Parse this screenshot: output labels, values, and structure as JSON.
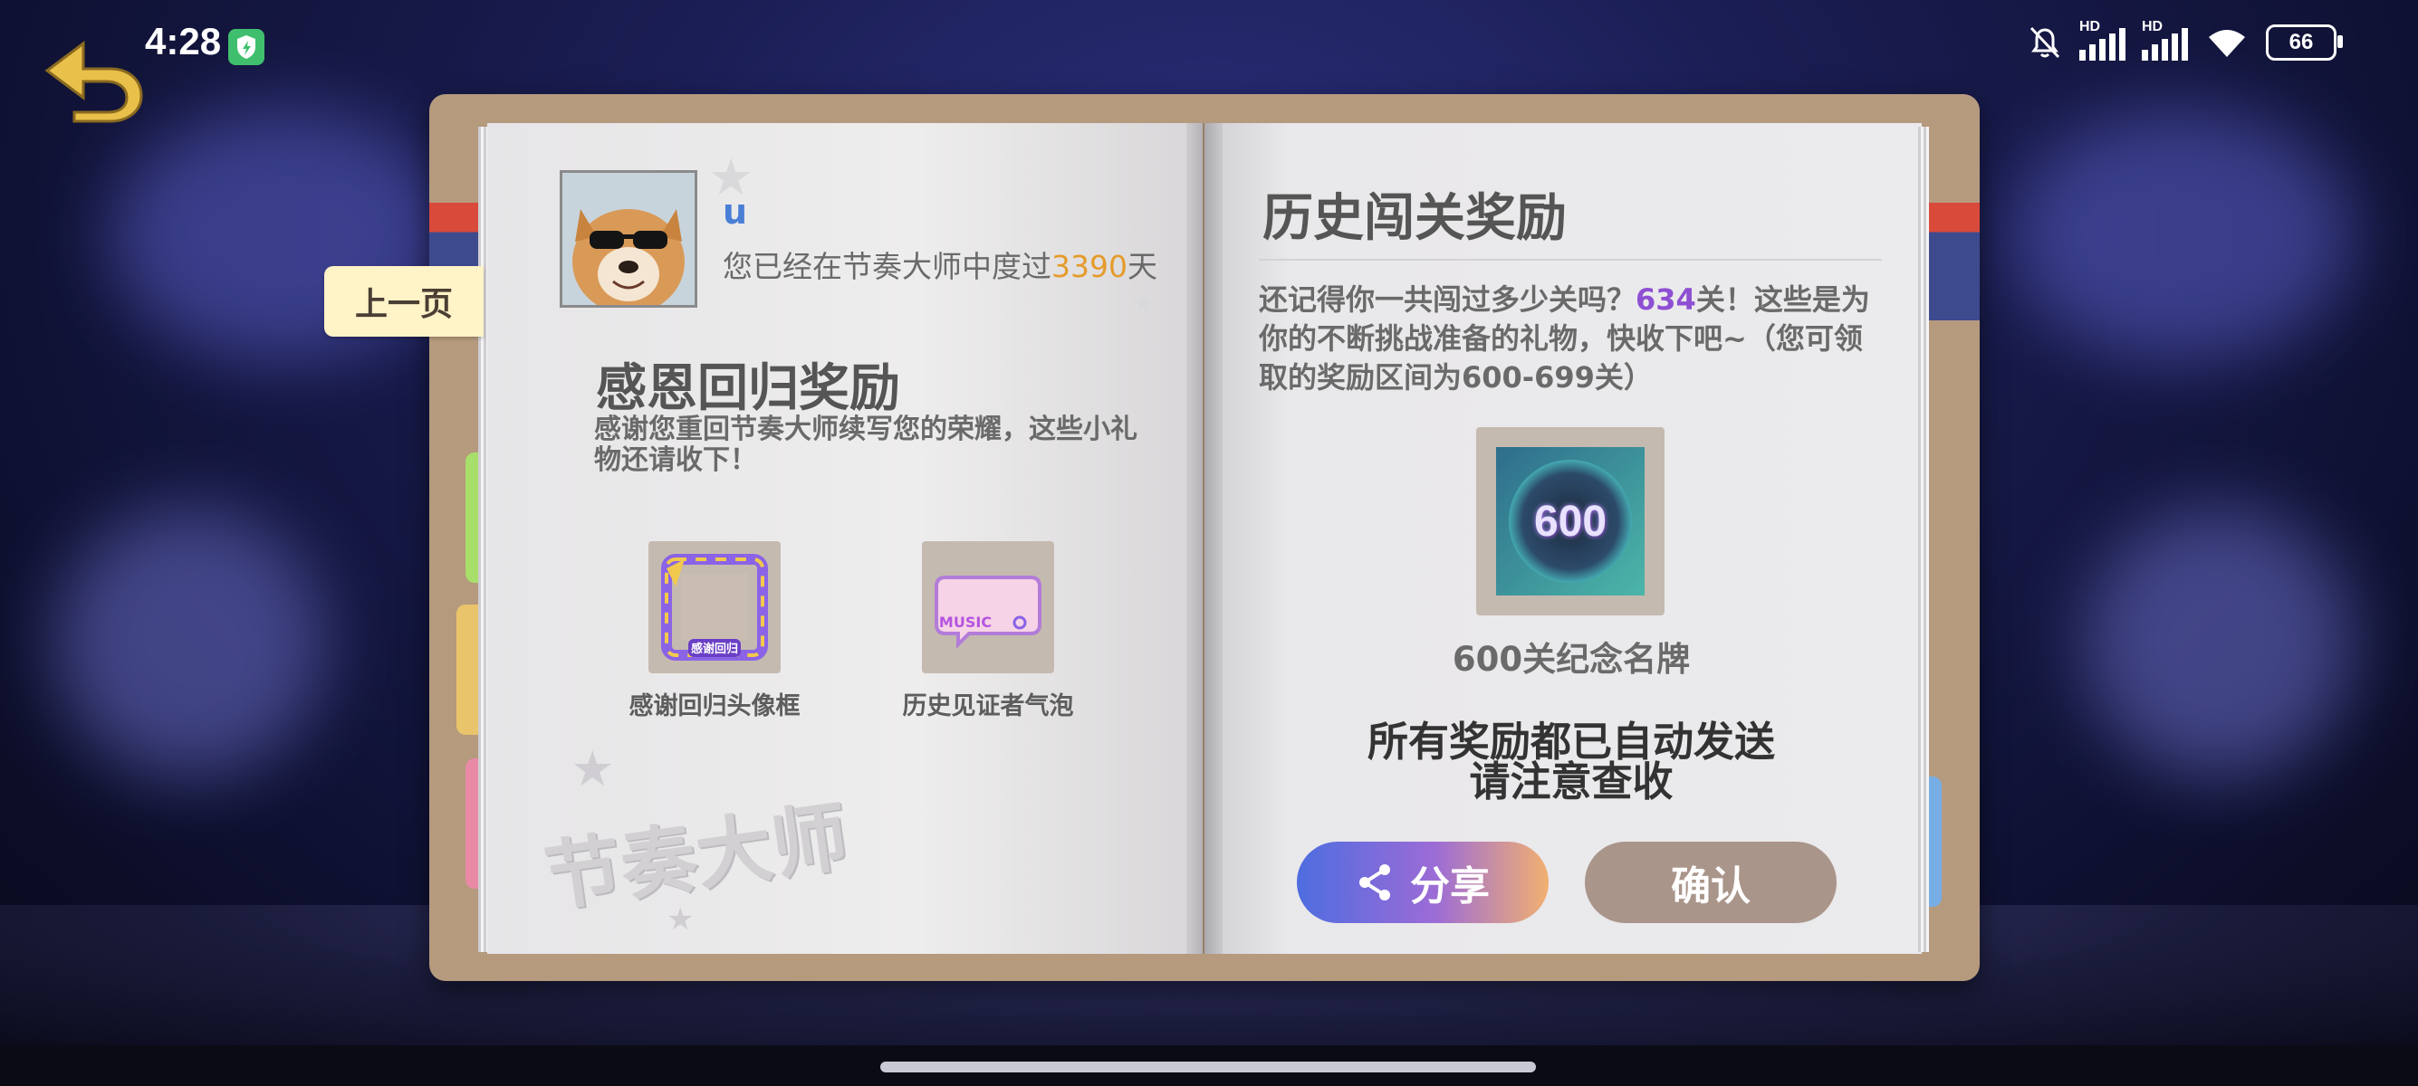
{
  "status_bar": {
    "time": "4:28",
    "battery": "66",
    "network_label": "HD",
    "icons": [
      "shield-icon",
      "bell-off-icon",
      "signal-icon",
      "wifi-icon",
      "battery-icon"
    ]
  },
  "navigation": {
    "back_icon": "back-arrow-icon",
    "prev_page_label": "上一页"
  },
  "left_page": {
    "username": "u",
    "days_prefix": "您已经在节奏大师中度过",
    "days_value": "3390",
    "days_suffix": "天",
    "title": "感恩回归奖励",
    "description": "感谢您重回节奏大师续写您的荣耀，这些小礼物还请收下！",
    "items": [
      {
        "label": "感谢回归头像框",
        "icon": "avatar-frame-icon"
      },
      {
        "label": "历史见证者气泡",
        "icon": "chat-bubble-icon"
      }
    ],
    "bubble_text": "MUSIC",
    "frame_text": "感谢回归",
    "watermark": "节奏大师"
  },
  "right_page": {
    "title": "历史闯关奖励",
    "desc_prefix": "还记得你一共闯过多少关吗？",
    "level_count": "634",
    "desc_suffix": "关！这些是为你的不断挑战准备的礼物，快收下吧~（您可领取的奖励区间为600-699关）",
    "plate_number": "600",
    "plate_label": "600关纪念名牌",
    "notice_line1": "所有奖励都已自动发送",
    "notice_line2": "请注意查收",
    "share_label": "分享",
    "confirm_label": "确认"
  },
  "colors": {
    "highlight_orange": "#e59b2b",
    "highlight_purple": "#8e4fd3",
    "username_blue": "#4a7fd6",
    "confirm_button": "#aa958a"
  }
}
